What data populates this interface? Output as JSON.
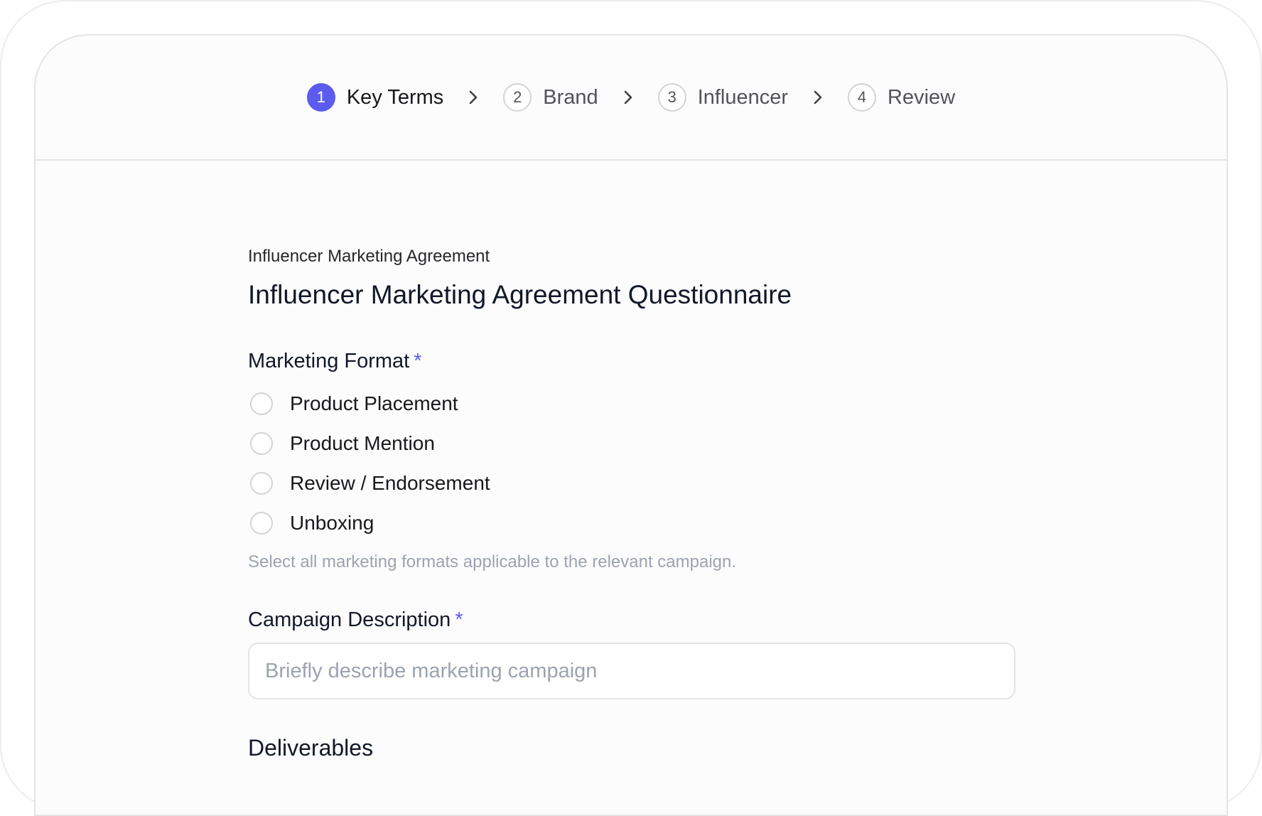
{
  "stepper": {
    "steps": [
      {
        "number": "1",
        "label": "Key Terms",
        "active": true
      },
      {
        "number": "2",
        "label": "Brand",
        "active": false
      },
      {
        "number": "3",
        "label": "Influencer",
        "active": false
      },
      {
        "number": "4",
        "label": "Review",
        "active": false
      }
    ],
    "separator_icon": "chevron-right-icon"
  },
  "form": {
    "eyebrow": "Influencer Marketing Agreement",
    "title": "Influencer Marketing Agreement Questionnaire",
    "marketing_format": {
      "label": "Marketing Format",
      "required_mark": "*",
      "options": [
        "Product Placement",
        "Product Mention",
        "Review / Endorsement",
        "Unboxing"
      ],
      "help": "Select all marketing formats applicable to the relevant campaign."
    },
    "campaign_description": {
      "label": "Campaign Description",
      "required_mark": "*",
      "placeholder": "Briefly describe marketing campaign",
      "value": ""
    },
    "deliverables_title": "Deliverables"
  },
  "colors": {
    "accent": "#5b5bef",
    "muted_text": "#9ca3af",
    "border": "#e4e4e7"
  }
}
